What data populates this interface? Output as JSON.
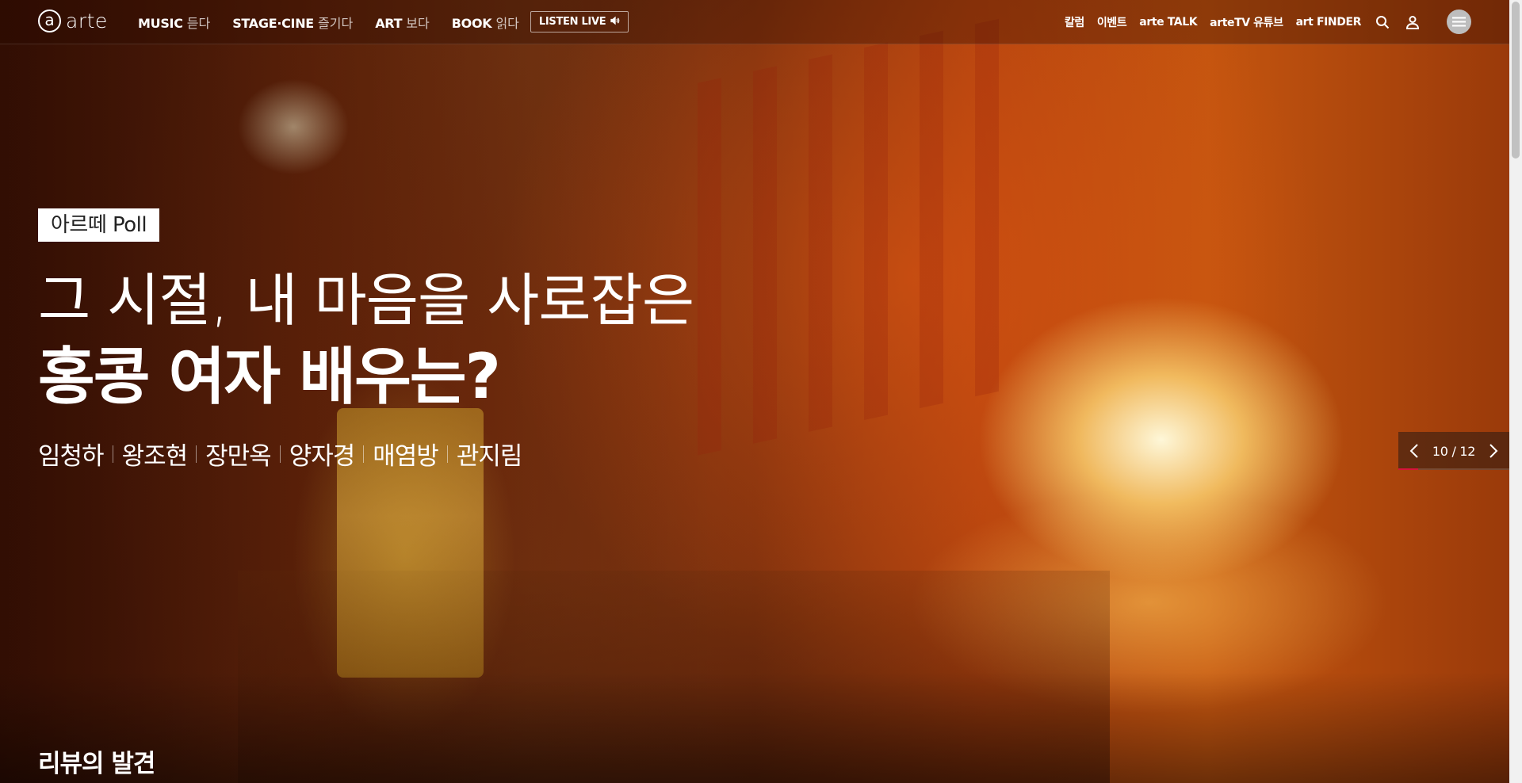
{
  "header": {
    "logo_text": "arte",
    "logo_mark": "a",
    "nav": [
      {
        "main": "MUSIC",
        "sub": "듣다"
      },
      {
        "main": "STAGE·CINE",
        "sub": "즐기다"
      },
      {
        "main": "ART",
        "sub": "보다"
      },
      {
        "main": "BOOK",
        "sub": "읽다"
      }
    ],
    "listen_live": "LISTEN LIVE",
    "util_links": [
      "칼럼",
      "이벤트",
      "arte TALK",
      "arteTV 유튜브",
      "art FINDER"
    ],
    "icons": [
      "search-icon",
      "user-icon",
      "hamburger-menu-icon"
    ]
  },
  "hero": {
    "tag": "아르떼 Poll",
    "headline_line1": "그 시절, 내 마음을 사로잡은",
    "headline_line2": "홍콩 여자 배우는?",
    "names": [
      "임청하",
      "왕조현",
      "장만옥",
      "양자경",
      "매염방",
      "관지림"
    ]
  },
  "slider": {
    "current": 10,
    "total": 12,
    "counter_text": "10 / 12",
    "progress_fraction": 0.18,
    "accent_color": "#d8143a"
  },
  "section": {
    "title": "리뷰의 발견"
  }
}
